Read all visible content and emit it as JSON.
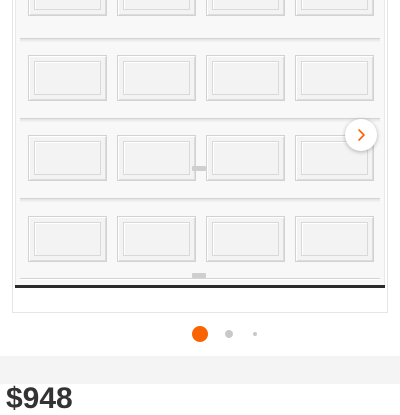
{
  "gallery": {
    "image_icon": "garage-door-product-image",
    "next_button_icon": "chevron-right-icon",
    "accent_color": "#f96302",
    "dots": [
      {
        "state": "active",
        "color": "#f96302"
      },
      {
        "state": "inactive",
        "color": "#c9c9c9"
      },
      {
        "state": "small",
        "color": "#c9c9c9"
      }
    ]
  },
  "product": {
    "price_label": "$948"
  }
}
